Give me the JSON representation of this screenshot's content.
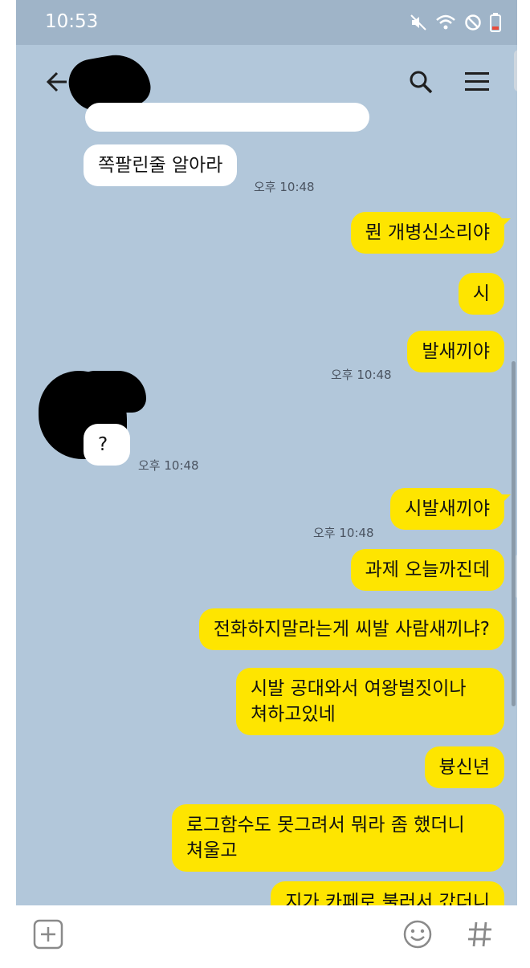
{
  "status": {
    "time": "10:53"
  },
  "messages": [
    {
      "text": "쪽팔린줄 알아라",
      "time": "오후 10:48"
    },
    {
      "text": "뭔 개병신소리야"
    },
    {
      "text": "시"
    },
    {
      "text": "발새끼야",
      "time": "오후 10:48"
    },
    {
      "text": "?",
      "time": "오후 10:48"
    },
    {
      "text": "시발새끼야",
      "time": "오후 10:48"
    },
    {
      "text": "과제 오늘까진데"
    },
    {
      "text": "전화하지말라는게 씨발 사람새끼냐?"
    },
    {
      "line1": "시발 공대와서 여왕벌짓이나",
      "line2": "쳐하고있네"
    },
    {
      "text": "븅신년"
    },
    {
      "line1": "로그함수도 못그려서 뭐라 좀 했더니",
      "line2": "쳐울고"
    },
    {
      "text": "지가 카페로 불러서 갔더니"
    }
  ],
  "icons": {
    "back": "back-arrow-icon",
    "search": "search-icon",
    "menu": "menu-icon",
    "add": "add-icon",
    "emoji": "emoji-icon",
    "hash": "hash-icon"
  },
  "colors": {
    "chat_bg": "#b2c7da",
    "outgoing": "#fee500",
    "incoming": "#ffffff"
  }
}
